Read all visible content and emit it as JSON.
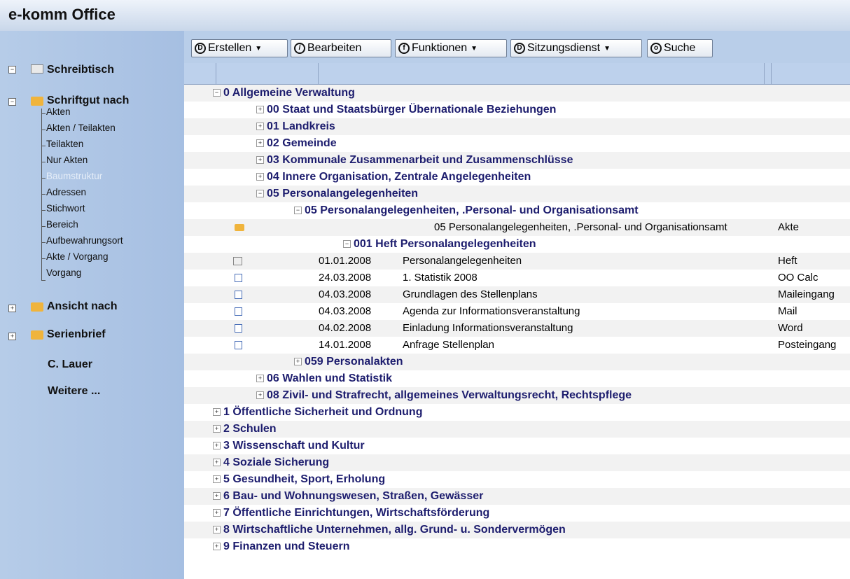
{
  "app": {
    "title": "e-komm Office"
  },
  "toolbar": {
    "erstellen": "Erstellen",
    "bearbeiten": "Bearbeiten",
    "funktionen": "Funktionen",
    "sitzungsdienst": "Sitzungsdienst",
    "suche": "Suche"
  },
  "sidebar": {
    "schreibtisch": "Schreibtisch",
    "schriftgut": "Schriftgut nach",
    "items": [
      "Akten",
      "Akten / Teilakten",
      "Teilakten",
      "Nur Akten",
      "Baumstruktur",
      "Adressen",
      "Stichwort",
      "Bereich",
      "Aufbewahrungsort",
      "Akte / Vorgang",
      "Vorgang"
    ],
    "ansicht": "Ansicht nach",
    "serienbrief": "Serienbrief",
    "user": "C. Lauer",
    "weitere": "Weitere ..."
  },
  "tree": {
    "n0": "0 Allgemeine Verwaltung",
    "n00": "00 Staat und Staatsbürger Übernationale Beziehungen",
    "n01": "01 Landkreis",
    "n02": "02 Gemeinde",
    "n03": "03 Kommunale Zusammenarbeit und Zusammenschlüsse",
    "n04": "04 Innere Organisation, Zentrale Angelegenheiten",
    "n05": "05 Personalangelegenheiten",
    "n05sub": "05 Personalangelegenheiten, .Personal- und Organisationsamt",
    "akte": {
      "title": "05 Personalangelegenheiten, .Personal- und Organisationsamt",
      "type": "Akte"
    },
    "heft": "001 Heft Personalangelegenheiten",
    "docs": [
      {
        "date": "01.01.2008",
        "title": "Personalangelegenheiten",
        "type": "Heft",
        "icon": "book-icon"
      },
      {
        "date": "24.03.2008",
        "title": "1. Statistik 2008",
        "type": "OO Calc",
        "icon": "document-icon"
      },
      {
        "date": "04.03.2008",
        "title": "Grundlagen des Stellenplans",
        "type": "Maileingang",
        "icon": "document-icon"
      },
      {
        "date": "04.03.2008",
        "title": "Agenda zur Informationsveranstaltung",
        "type": "Mail",
        "icon": "document-icon"
      },
      {
        "date": "04.02.2008",
        "title": "Einladung Informationsveranstaltung",
        "type": "Word",
        "icon": "document-icon"
      },
      {
        "date": "14.01.2008",
        "title": "Anfrage Stellenplan",
        "type": "Posteingang",
        "icon": "document-icon"
      }
    ],
    "n059": "059 Personalakten",
    "n06": "06 Wahlen und Statistik",
    "n08": "08 Zivil- und Strafrecht, allgemeines Verwaltungsrecht, Rechtspflege",
    "n1": "1 Öffentliche Sicherheit und Ordnung",
    "n2": "2 Schulen",
    "n3": "3 Wissenschaft und Kultur",
    "n4": "4 Soziale Sicherung",
    "n5": "5 Gesundheit, Sport, Erholung",
    "n6": "6 Bau- und Wohnungswesen, Straßen, Gewässer",
    "n7": "7 Öffentliche Einrichtungen, Wirtschaftsförderung",
    "n8": "8 Wirtschaftliche Unternehmen, allg. Grund- u. Sondervermögen",
    "n9": "9 Finanzen und Steuern"
  }
}
